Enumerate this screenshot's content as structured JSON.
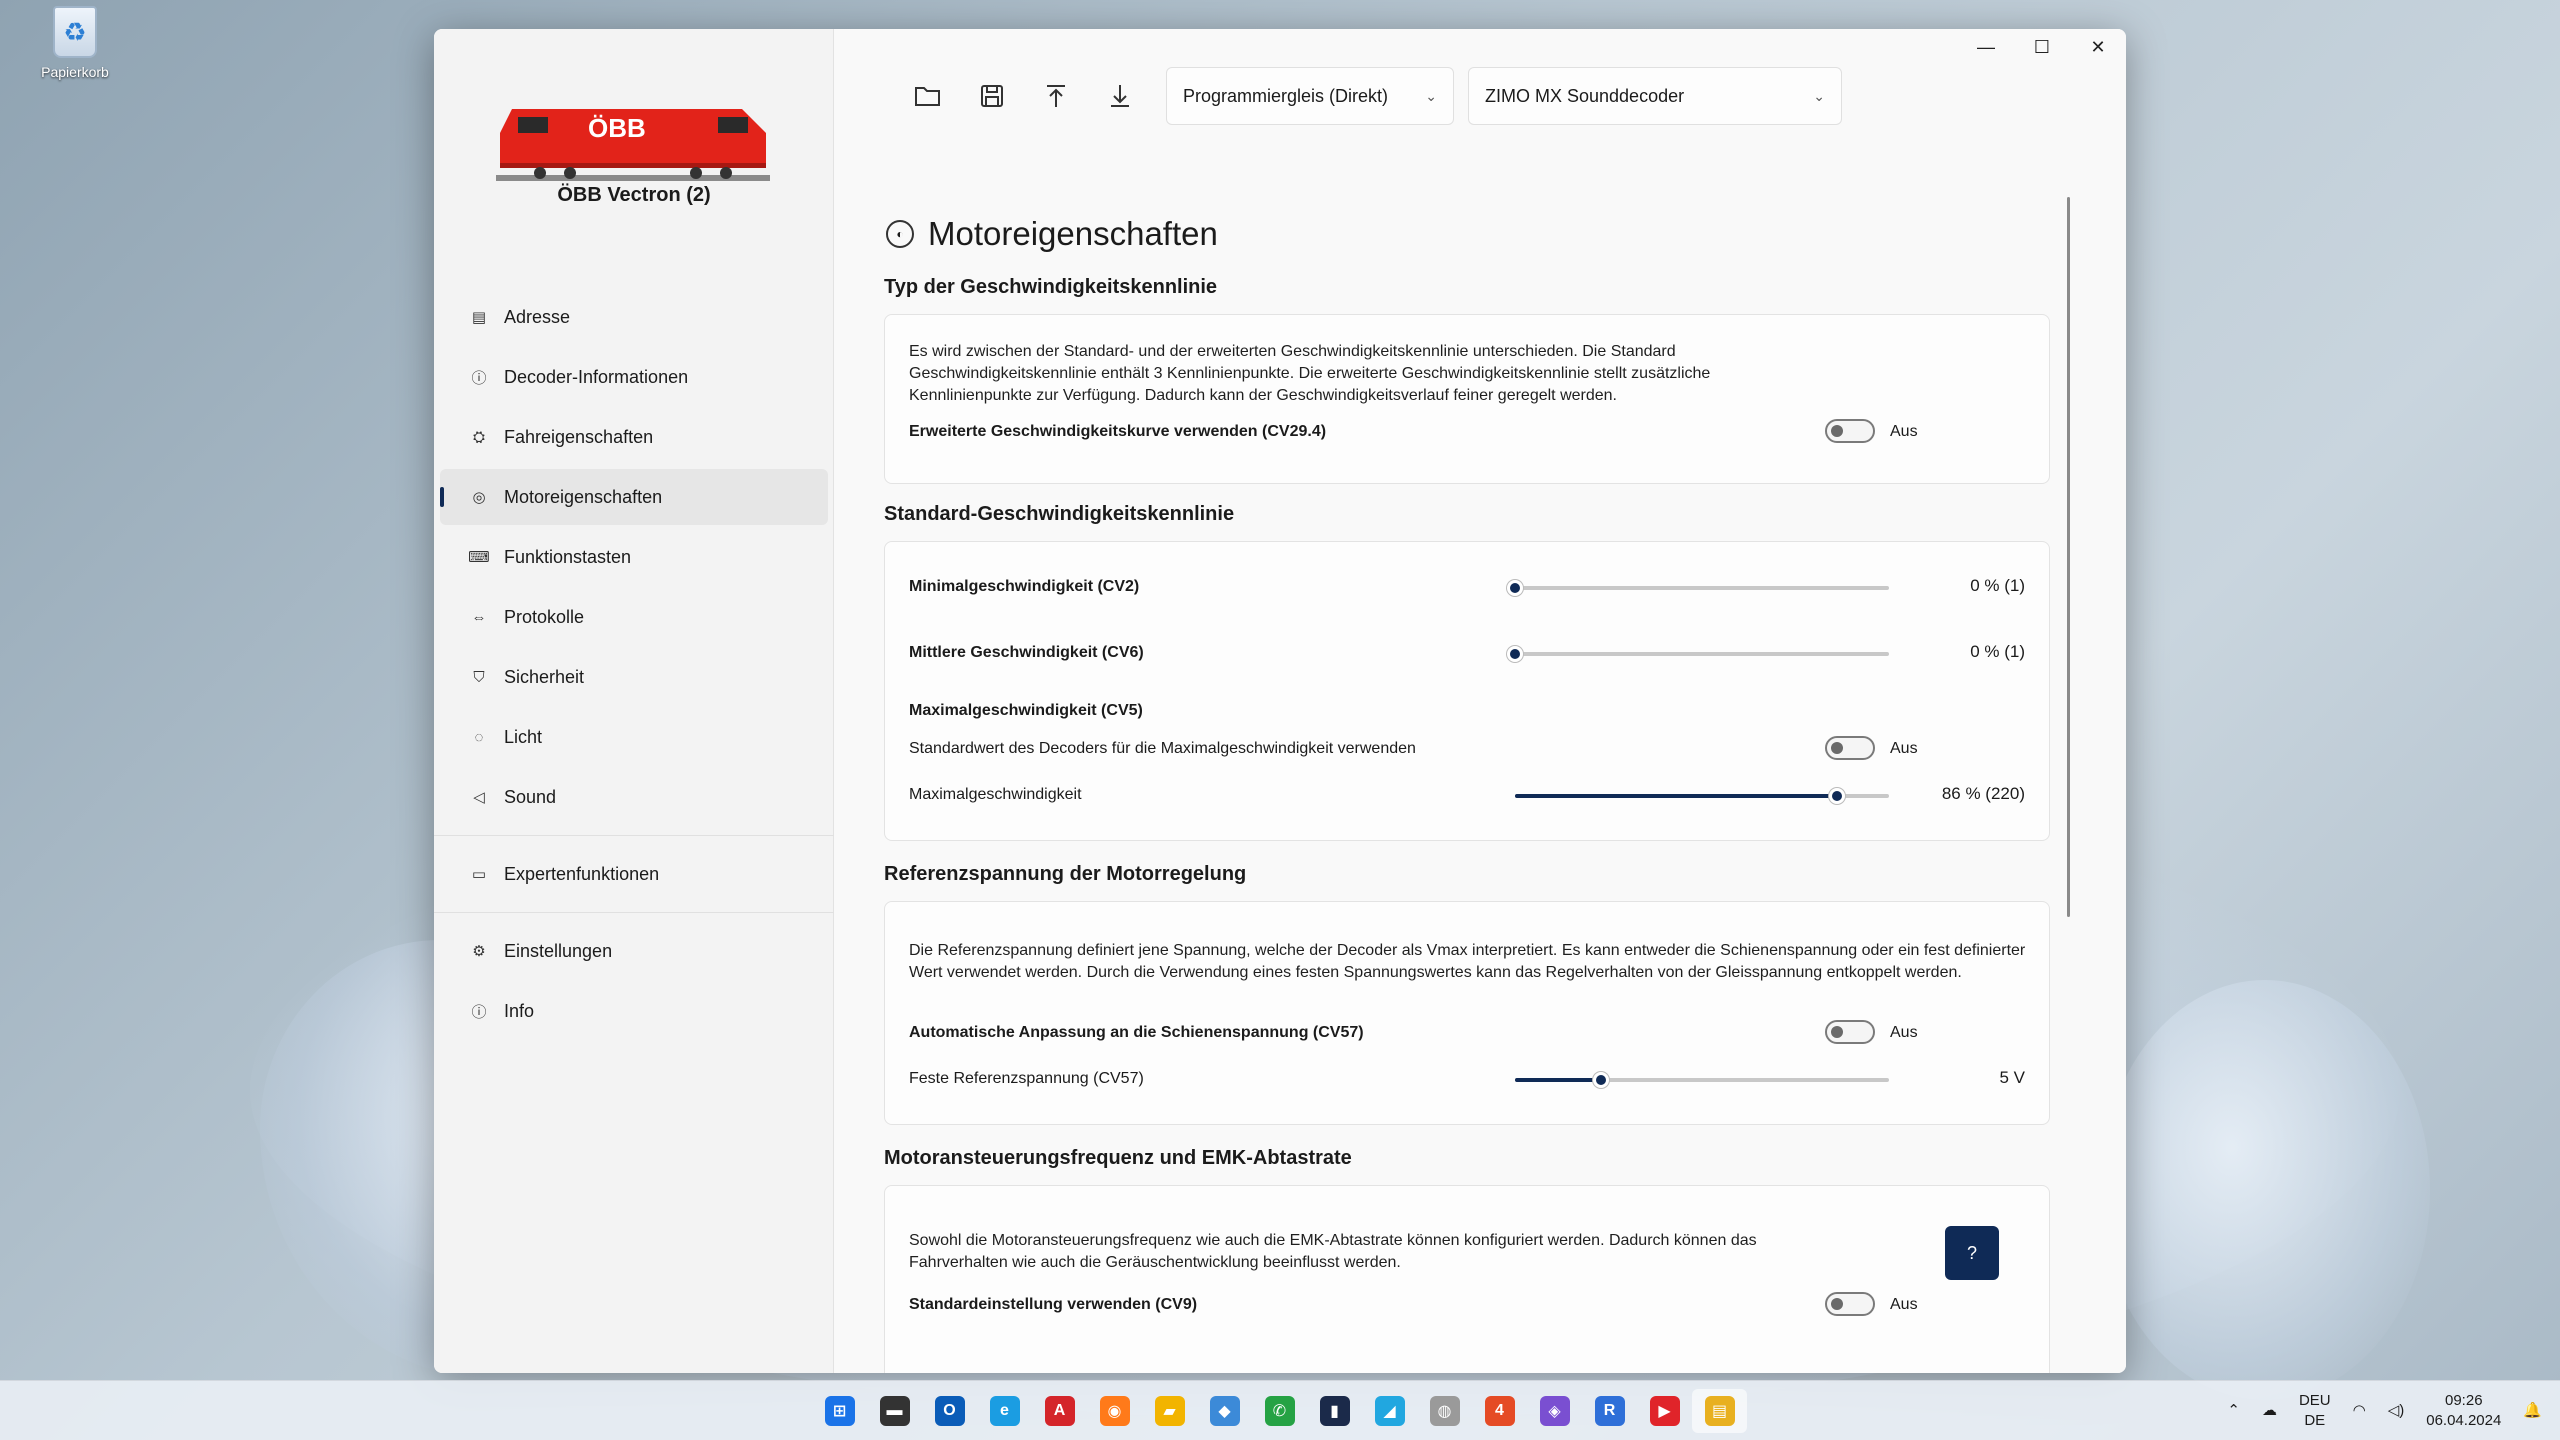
{
  "desktop": {
    "recycle_bin_label": "Papierkorb"
  },
  "window": {
    "minimize": "—",
    "maximize": "☐",
    "close": "✕"
  },
  "sidebar": {
    "locomotive_name": "ÖBB Vectron (2)",
    "train_logo_text": "ÖBB",
    "items": [
      {
        "label": "Adresse",
        "icon": "address-card-icon",
        "glyph": "▤"
      },
      {
        "label": "Decoder-Informationen",
        "icon": "info-icon",
        "glyph": "ⓘ"
      },
      {
        "label": "Fahreigenschaften",
        "icon": "speedometer-icon",
        "glyph": "⛭"
      },
      {
        "label": "Motoreigenschaften",
        "icon": "motor-icon",
        "glyph": "◎"
      },
      {
        "label": "Funktionstasten",
        "icon": "keyboard-icon",
        "glyph": "⌨"
      },
      {
        "label": "Protokolle",
        "icon": "arrows-icon",
        "glyph": "⇔"
      },
      {
        "label": "Sicherheit",
        "icon": "shield-icon",
        "glyph": "⛉"
      },
      {
        "label": "Licht",
        "icon": "lightbulb-icon",
        "glyph": "💡"
      },
      {
        "label": "Sound",
        "icon": "speaker-icon",
        "glyph": "🔈"
      },
      {
        "label": "Expertenfunktionen",
        "icon": "toolbox-icon",
        "glyph": "🧰"
      },
      {
        "label": "Einstellungen",
        "icon": "gear-icon",
        "glyph": "⚙"
      },
      {
        "label": "Info",
        "icon": "info-icon",
        "glyph": "ⓘ"
      }
    ],
    "active_index": 3
  },
  "toolbar": {
    "track_select": "Programmiergleis (Direkt)",
    "decoder_select": "ZIMO MX Sounddecoder"
  },
  "page": {
    "title": "Motoreigenschaften",
    "sections": {
      "speed_curve_type": {
        "title": "Typ der Geschwindigkeitskennlinie",
        "description": "Es wird zwischen der Standard- und der erweiterten Geschwindigkeitskennlinie unterschieden. Die Standard Geschwindigkeitskennlinie enthält 3 Kennlinienpunkte. Die erweiterte Geschwindigkeitskennlinie stellt zusätzliche Kennlinienpunkte zur Verfügung. Dadurch kann der Geschwindigkeitsverlauf feiner geregelt werden.",
        "toggle_label": "Erweiterte Geschwindigkeitskurve verwenden (CV29.4)",
        "toggle_state": "Aus"
      },
      "standard_curve": {
        "title": "Standard-Geschwindigkeitskennlinie",
        "min_label": "Minimalgeschwindigkeit (CV2)",
        "min_value": "0 % (1)",
        "min_fraction": 0.0,
        "mid_label": "Mittlere Geschwindigkeit (CV6)",
        "mid_value": "0 % (1)",
        "mid_fraction": 0.0,
        "max_heading": "Maximalgeschwindigkeit (CV5)",
        "max_default_label": "Standardwert des Decoders für die Maximalgeschwindigkeit verwenden",
        "max_default_state": "Aus",
        "max_label": "Maximalgeschwindigkeit",
        "max_value": "86 % (220)",
        "max_fraction": 0.86
      },
      "reference_voltage": {
        "title": "Referenzspannung der Motorregelung",
        "description": "Die Referenzspannung definiert jene Spannung, welche der Decoder als Vmax interpretiert. Es kann entweder die Schienenspannung oder ein fest definierter Wert verwendet werden. Durch die Verwendung eines festen Spannungswertes kann das Regelverhalten von der Gleisspannung entkoppelt werden.",
        "toggle_label": "Automatische Anpassung an die Schienenspannung (CV57)",
        "toggle_state": "Aus",
        "fixed_label": "Feste Referenzspannung (CV57)",
        "fixed_value": "5 V",
        "fixed_fraction": 0.23
      },
      "frequency": {
        "title": "Motoransteuerungsfrequenz und EMK-Abtastrate",
        "description": "Sowohl die Motoransteuerungsfrequenz wie auch die EMK-Abtastrate können konfiguriert werden. Dadurch können das Fahrverhalten wie auch die Geräuschentwicklung beeinflusst werden.",
        "help_label": "?",
        "toggle_label": "Standardeinstellung verwenden (CV9)",
        "toggle_state": "Aus"
      }
    }
  },
  "taskbar": {
    "apps": [
      {
        "name": "start-icon",
        "glyph": "⊞",
        "color": "#1a73e8"
      },
      {
        "name": "file-manager-icon",
        "glyph": "▬",
        "color": "#333333"
      },
      {
        "name": "outlook-icon",
        "glyph": "O",
        "color": "#0a5cb8"
      },
      {
        "name": "edge-icon",
        "glyph": "e",
        "color": "#1b9de2"
      },
      {
        "name": "acrobat-icon",
        "glyph": "A",
        "color": "#d4252a"
      },
      {
        "name": "firefox-icon",
        "glyph": "◉",
        "color": "#ff7a1a"
      },
      {
        "name": "explorer-icon",
        "glyph": "▰",
        "color": "#f2b400"
      },
      {
        "name": "paint-icon",
        "glyph": "◆",
        "color": "#3c8ad8"
      },
      {
        "name": "whatsapp-icon",
        "glyph": "✆",
        "color": "#25a244"
      },
      {
        "name": "terminal-icon",
        "glyph": "▮",
        "color": "#1b2a4a"
      },
      {
        "name": "app-icon",
        "glyph": "◢",
        "color": "#21a7e0"
      },
      {
        "name": "app-icon",
        "glyph": "◍",
        "color": "#9a9a9a"
      },
      {
        "name": "app-icon",
        "glyph": "4",
        "color": "#e54b25"
      },
      {
        "name": "visual-studio-icon",
        "glyph": "◈",
        "color": "#7a4fd1"
      },
      {
        "name": "app-icon",
        "glyph": "R",
        "color": "#2e6fd8"
      },
      {
        "name": "media-icon",
        "glyph": "▶",
        "color": "#e0242a"
      },
      {
        "name": "app-icon",
        "glyph": "▤",
        "color": "#e8b020"
      }
    ],
    "active_app_index": 16,
    "tray": {
      "lang_top": "DEU",
      "lang_bottom": "DE",
      "time": "09:26",
      "date": "06.04.2024"
    }
  }
}
